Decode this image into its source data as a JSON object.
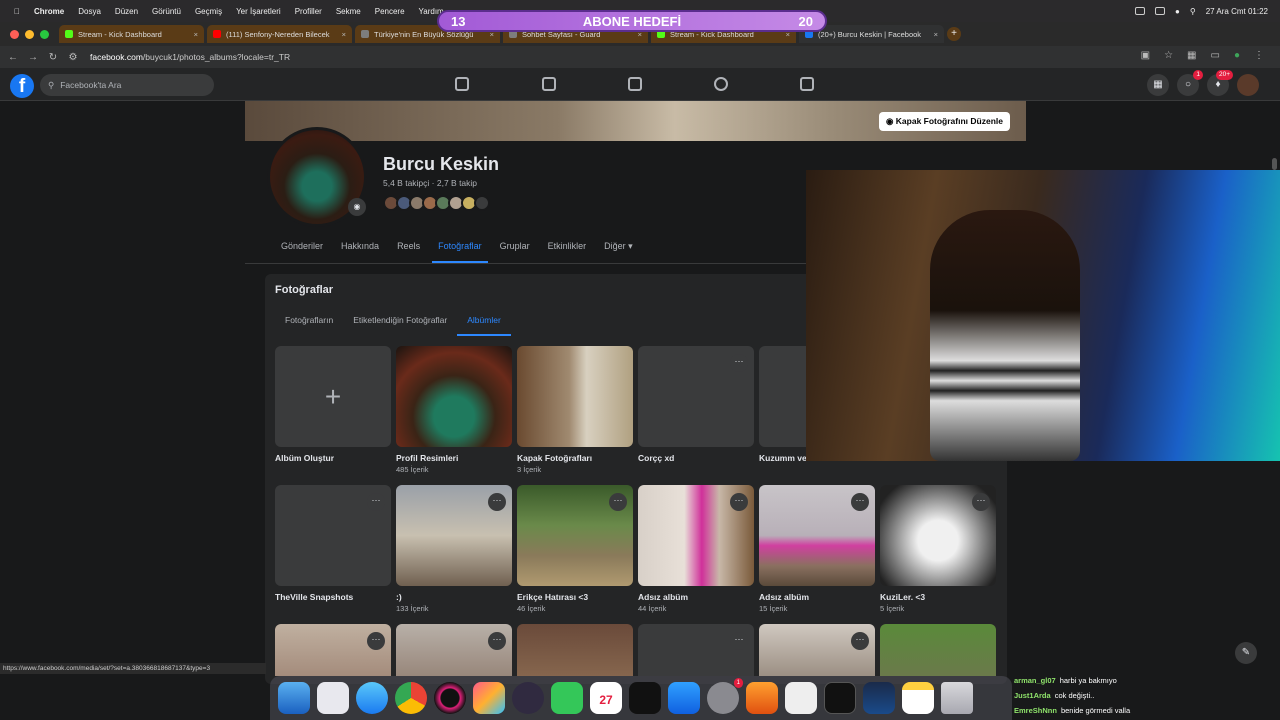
{
  "menubar": {
    "items": [
      "Chrome",
      "Dosya",
      "Düzen",
      "Görüntü",
      "Geçmiş",
      "Yer İşaretleri",
      "Profiller",
      "Sekme",
      "Pencere",
      "Yardım"
    ],
    "clock": "27 Ara Cmt  01:22"
  },
  "abone": {
    "left": "13",
    "label": "ABONE HEDEFİ",
    "right": "20"
  },
  "tabs": [
    {
      "label": "Stream - Kick Dashboard",
      "color": "#53fc18"
    },
    {
      "label": "(111) Senfony-Nereden Bilecek",
      "color": "#ff0000"
    },
    {
      "label": "Türkiye'nin En Büyük Sözlüğü",
      "color": "#7d7d7d"
    },
    {
      "label": "Sohbet Sayfası - Guard",
      "color": "#7d7d7d"
    },
    {
      "label": "Stream - Kick Dashboard",
      "color": "#53fc18"
    },
    {
      "label": "(20+) Burcu Keskin | Facebook",
      "color": "#1877f2"
    }
  ],
  "address": {
    "host": "facebook.com",
    "path": "/buycuk1/photos_albums?locale=tr_TR"
  },
  "fb": {
    "search_placeholder": "Facebook'ta Ara",
    "messenger_badge": "1",
    "notif_badge": "20+",
    "cover_button": "Kapak Fotoğrafını Düzenle",
    "profile_name": "Burcu Keskin",
    "profile_stats": "5,4 B takipçi · 2,7 B takip",
    "tabs": [
      "Gönderiler",
      "Hakkında",
      "Reels",
      "Fotoğraflar",
      "Gruplar",
      "Etkinlikler",
      "Diğer ▾"
    ],
    "photos_title": "Fotoğraflar",
    "subtabs": [
      "Fotoğrafların",
      "Etiketlendiğin Fotoğraflar",
      "Albümler"
    ],
    "albums_row1": [
      {
        "name": "Albüm Oluştur",
        "count": ""
      },
      {
        "name": "Profil Resimleri",
        "count": "485 İçerik"
      },
      {
        "name": "Kapak Fotoğrafları",
        "count": "3 İçerik"
      },
      {
        "name": "Corçç xd",
        "count": ""
      },
      {
        "name": "Kuzumm ve ...",
        "count": ""
      }
    ],
    "albums_row2": [
      {
        "name": "TheVille Snapshots",
        "count": ""
      },
      {
        "name": ":)",
        "count": "133 İçerik"
      },
      {
        "name": "Erikçe Hatırası <3",
        "count": "46 İçerik"
      },
      {
        "name": "Adsız albüm",
        "count": "44 İçerik"
      },
      {
        "name": "Adsız albüm",
        "count": "15 İçerik"
      },
      {
        "name": "KuziLer. <3",
        "count": "5 İçerik"
      }
    ],
    "more_glyph": "···"
  },
  "status_url": "https://www.facebook.com/media/set/?set=a.380366818687137&type=3",
  "dock_badge": "1",
  "calendar_day": "27",
  "chat": [
    {
      "user": "arman_gl07",
      "msg": "harbi ya bakmıyo"
    },
    {
      "user": "Just1Arda",
      "msg": "cok değişti.."
    },
    {
      "user": "EmreShNnn",
      "msg": "benide görmedi valla"
    }
  ]
}
